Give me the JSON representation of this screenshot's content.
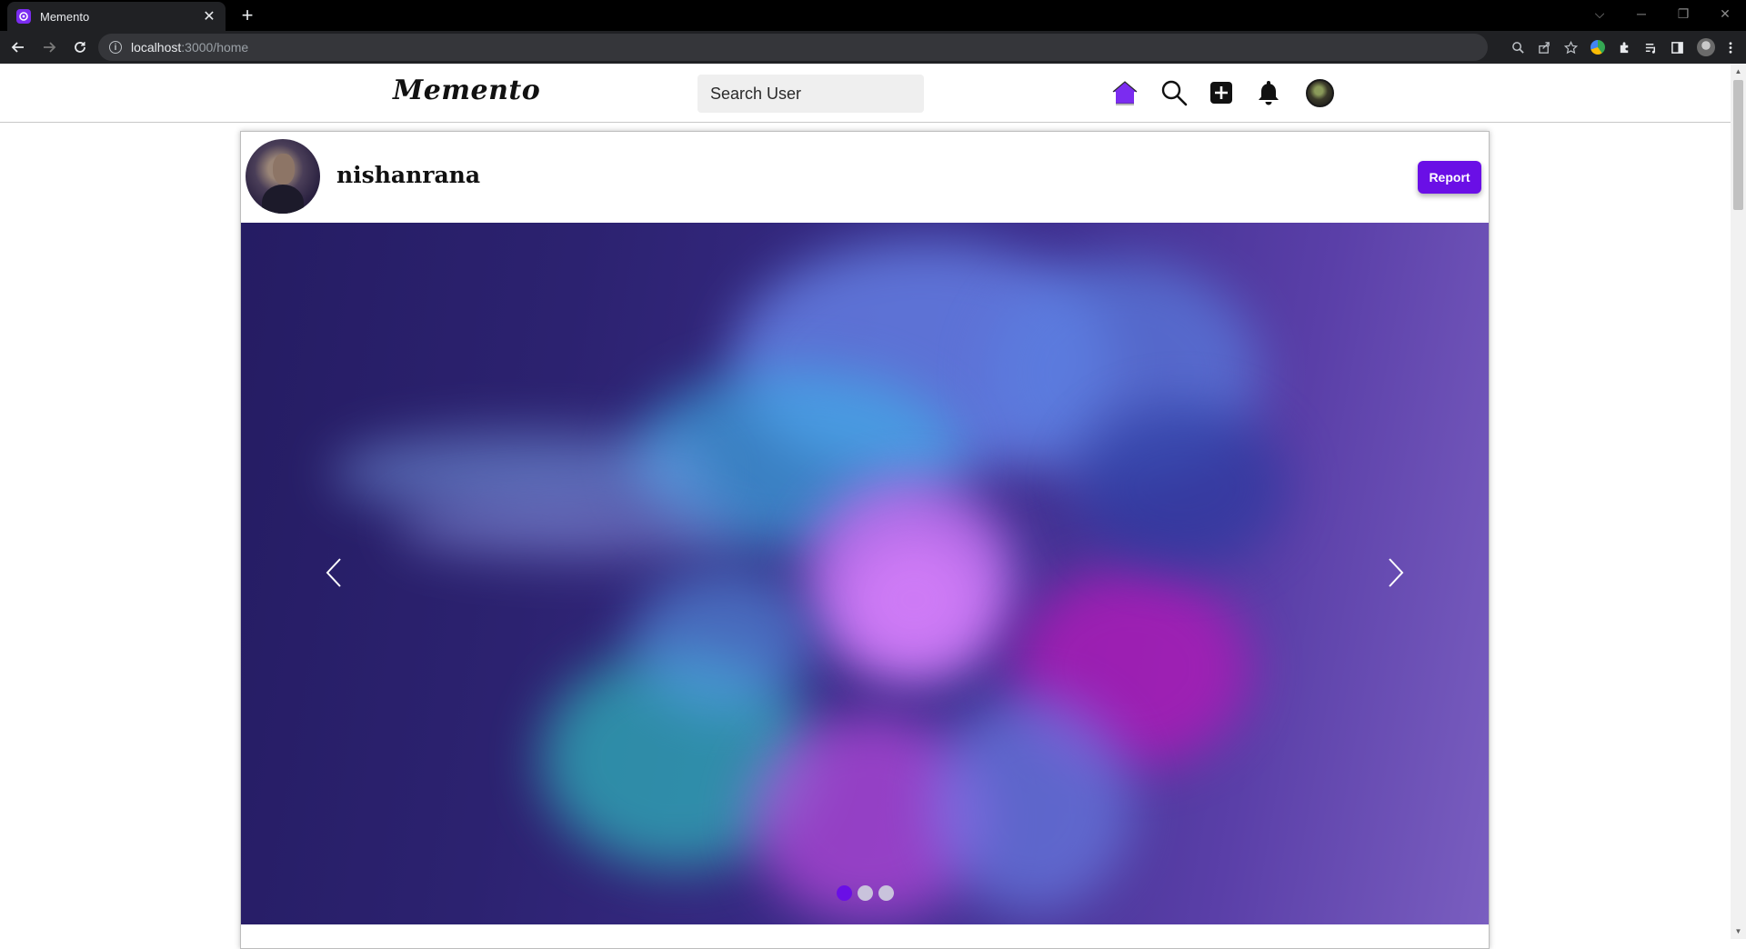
{
  "browser": {
    "tab_title": "Memento",
    "tab_close": "✕",
    "new_tab": "+",
    "url_host": "localhost",
    "url_path": ":3000/home",
    "info_icon": "i",
    "window_controls": [
      "⌵",
      "─",
      "❐",
      "✕"
    ]
  },
  "header": {
    "logo": "Memento",
    "search": {
      "placeholder": "Search User"
    },
    "icons": [
      "home-icon",
      "search-icon",
      "add-post-icon",
      "bell-icon",
      "avatar"
    ],
    "accent_color": "#7b2cf0"
  },
  "post": {
    "author": "nishanrana",
    "report_label": "Report",
    "report_color": "#6a0fe6",
    "carousel": {
      "slide_count": 3,
      "active_index": 0
    }
  }
}
